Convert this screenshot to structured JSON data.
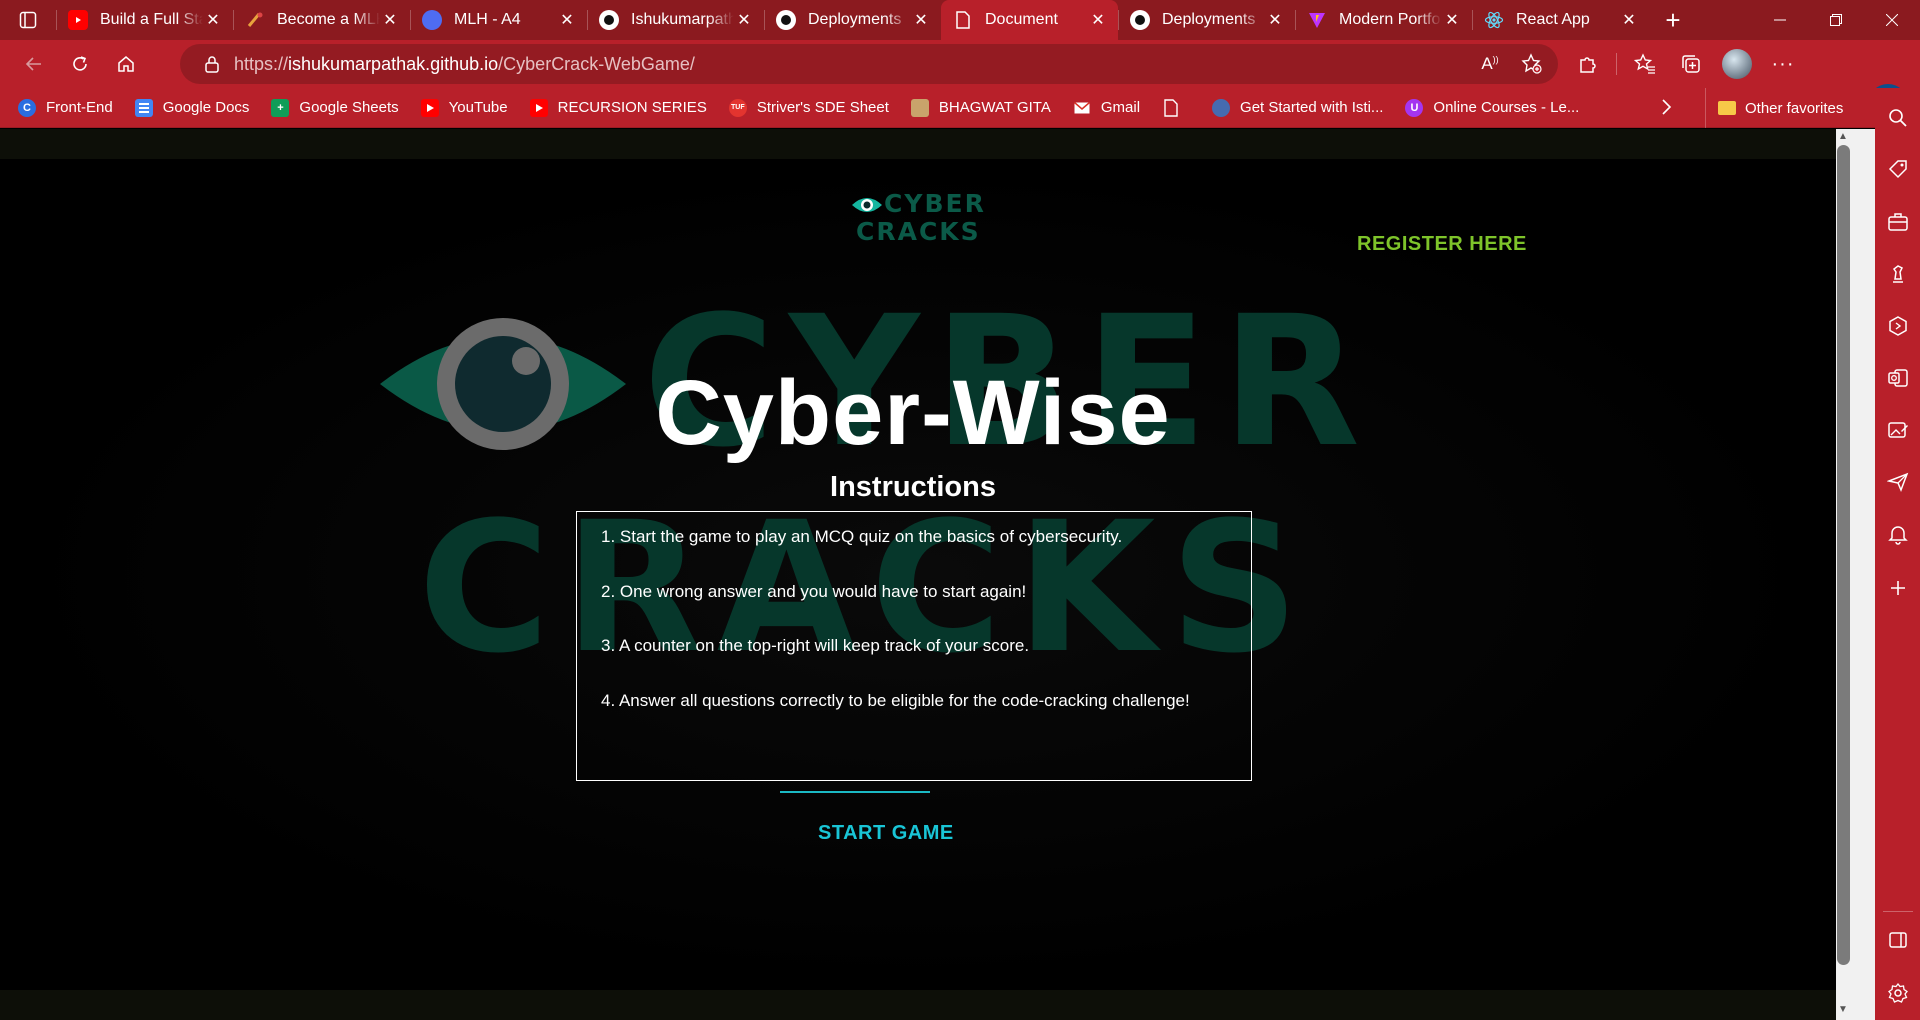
{
  "browser": {
    "tabs": [
      {
        "title": "Build a Full Stack",
        "favicon": "youtube-icon",
        "color": "#ff0000",
        "active": false
      },
      {
        "title": "Become a MLH",
        "favicon": "mlh-icon",
        "color": "#e8a33d",
        "active": false
      },
      {
        "title": "MLH - A4",
        "favicon": "doc-icon",
        "color": "#4e6cf2",
        "active": false
      },
      {
        "title": "Ishukumarpathak",
        "favicon": "github-icon",
        "color": "#ffffff",
        "active": false
      },
      {
        "title": "Deployments",
        "favicon": "github-icon",
        "color": "#ffffff",
        "active": false
      },
      {
        "title": "Document",
        "favicon": "page-icon",
        "color": "#ffffff",
        "active": true
      },
      {
        "title": "Deployments",
        "favicon": "github-icon",
        "color": "#ffffff",
        "active": false
      },
      {
        "title": "Modern Portfolio",
        "favicon": "vite-icon",
        "color": "#bd34fe",
        "active": false
      },
      {
        "title": "React App",
        "favicon": "react-icon",
        "color": "#61dafb",
        "active": false
      }
    ],
    "url_prefix": "https://",
    "url_host": "ishukumarpathak.github.io",
    "url_path": "/CyberCrack-WebGame/",
    "bookmarks": [
      {
        "label": "Front-End",
        "icon": "c-icon",
        "color": "#2b6de0"
      },
      {
        "label": "Google Docs",
        "icon": "google-docs-icon",
        "color": "#4285f4"
      },
      {
        "label": "Google Sheets",
        "icon": "google-sheets-icon",
        "color": "#0f9d58"
      },
      {
        "label": "YouTube",
        "icon": "youtube-icon",
        "color": "#ff0000"
      },
      {
        "label": "RECURSION SERIES",
        "icon": "youtube-icon",
        "color": "#ff0000"
      },
      {
        "label": "Striver's SDE Sheet",
        "icon": "tuf-icon",
        "color": "#e3342f"
      },
      {
        "label": "BHAGWAT GITA",
        "icon": "image-icon",
        "color": "#c9a36b"
      },
      {
        "label": "Gmail",
        "icon": "gmail-icon",
        "color": "#ffffff"
      },
      {
        "label": "",
        "icon": "page-icon",
        "color": "#ffffff"
      },
      {
        "label": "Get Started with Isti...",
        "icon": "istio-icon",
        "color": "#466bb0"
      },
      {
        "label": "Online Courses - Le...",
        "icon": "udemy-icon",
        "color": "#a435f0"
      }
    ],
    "other_favorites": "Other favorites"
  },
  "page": {
    "logo_line1": "CYBER",
    "logo_line2": "CRACKS",
    "register_label": "REGISTER HERE",
    "title": "Cyber-Wise",
    "instructions_title": "Instructions",
    "instructions": [
      "1. Start the game to play an MCQ quiz on the basics of cybersecurity.",
      "2. One wrong answer and you would have to start again!",
      "3. A counter on the top-right will keep track of your score.",
      "4. Answer all questions correctly to be eligible for the code-cracking challenge!"
    ],
    "start_label": "START GAME",
    "colors": {
      "accent": "#19c5d6",
      "register": "#7ec42a",
      "logo": "#0b5a48"
    }
  }
}
